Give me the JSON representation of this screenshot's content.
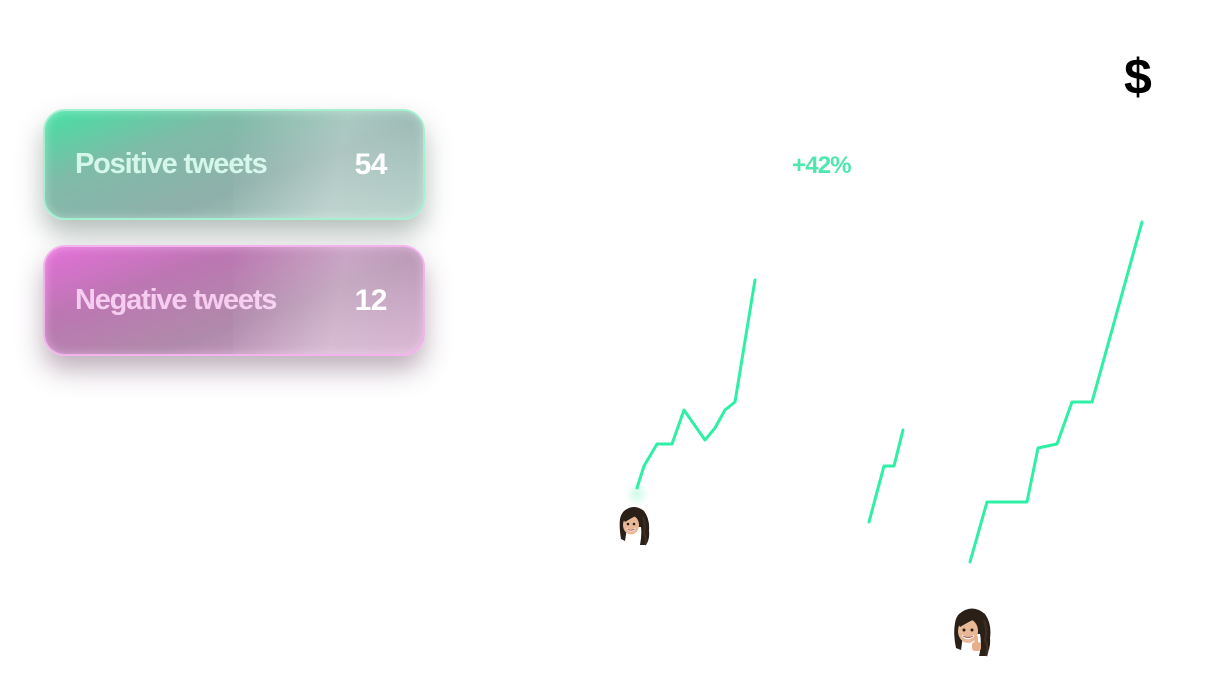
{
  "cards": {
    "positive": {
      "label": "Positive tweets",
      "count": "54",
      "color": "#45e0a4"
    },
    "negative": {
      "label": "Negative tweets",
      "count": "12",
      "color": "#e46fd9"
    }
  },
  "growth": {
    "label": "+42%",
    "color": "#4ee8ae"
  },
  "currency_symbol": "$",
  "colors": {
    "line": "#2ef0a4",
    "background": "#ffffff"
  },
  "icons": {
    "avatar_a": "memoji-avatar-icon",
    "avatar_b": "memoji-thumbs-up-avatar-icon"
  }
}
